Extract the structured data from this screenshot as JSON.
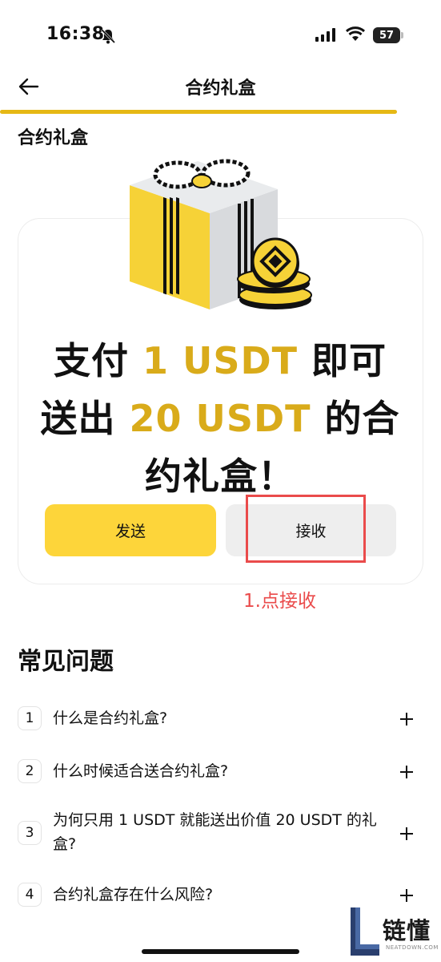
{
  "status_bar": {
    "time": "16:38",
    "battery": "57"
  },
  "nav": {
    "title": "合约礼盒",
    "progress": 0.9
  },
  "section": {
    "title": "合约礼盒"
  },
  "promo": {
    "line1_a": "支付 ",
    "line1_accent": "1 USDT",
    "line1_b": " 即可",
    "line2_a": "送出 ",
    "line2_accent": "20 USDT",
    "line2_b": " 的合",
    "line3": "约礼盒！",
    "send_label": "发送",
    "receive_label": "接收"
  },
  "annotation": {
    "text": "1.点接收"
  },
  "faq": {
    "title": "常见问题",
    "items": [
      {
        "num": "1",
        "text": "什么是合约礼盒?"
      },
      {
        "num": "2",
        "text": "什么时候适合送合约礼盒?"
      },
      {
        "num": "3",
        "text": "为何只用 1 USDT 就能送出价值 20 USDT 的礼盒?"
      },
      {
        "num": "4",
        "text": "合约礼盒存在什么风险?"
      }
    ]
  },
  "watermark": {
    "text": "链懂",
    "sub": "NEATDOWN.COM"
  },
  "colors": {
    "accent": "#fdd53a",
    "accent_text": "#d9ab1a",
    "annotation": "#ea4b4b"
  },
  "icons": [
    "bell-slash-icon",
    "signal-icon",
    "wifi-icon",
    "battery-icon",
    "back-arrow-icon",
    "plus-icon",
    "gift-box-icon",
    "coin-icon"
  ]
}
